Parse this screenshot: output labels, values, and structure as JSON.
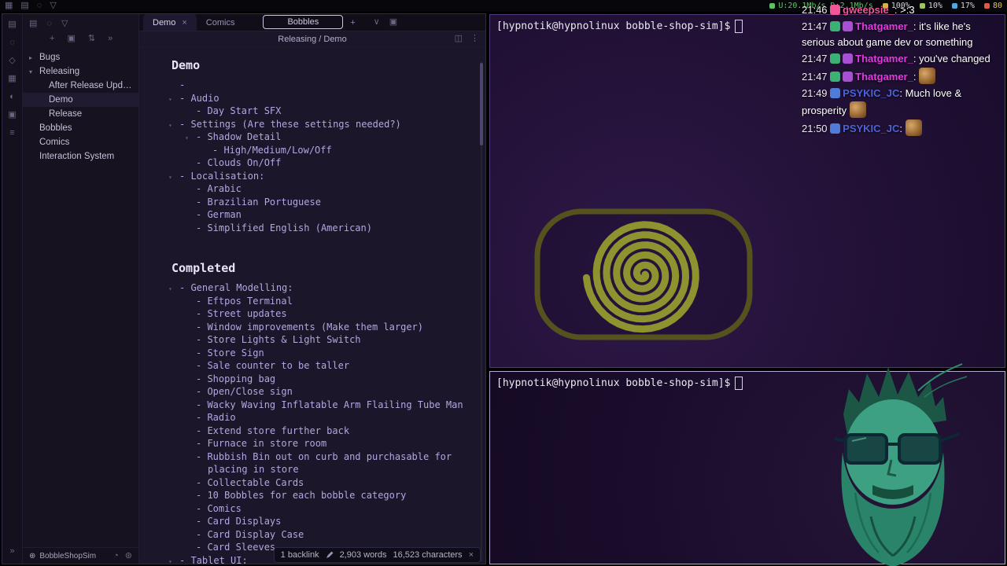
{
  "colors": {
    "accent_purple": "#7a5dd6",
    "focused_border": "#b7a6d3",
    "terminal_bg": "#241239",
    "editor_text": "#b4a7e2"
  },
  "topbar": {
    "left_icons": [
      {
        "name": "apps-icon",
        "glyph": "▦"
      },
      {
        "name": "layout-icon",
        "glyph": "▤"
      },
      {
        "name": "search-icon",
        "glyph": "◌"
      },
      {
        "name": "bookmark-icon",
        "glyph": "▽"
      }
    ],
    "stats": [
      {
        "name": "network",
        "text": "U:20.1Mb/s D:2.1Mb/s",
        "color": "#5dc264",
        "dot": "#5dc264"
      },
      {
        "name": "volume",
        "text": "100%",
        "color": "#d6d3de",
        "dot": "#d4b544"
      },
      {
        "name": "brightness",
        "text": "10%",
        "color": "#d6d3de",
        "dot": "#9ec45a"
      },
      {
        "name": "disk-usage",
        "text": "17%",
        "color": "#d6d3de",
        "dot": "#4fa7dd"
      },
      {
        "name": "cpu-temp",
        "text": "80",
        "color": "#e0c25a",
        "dot": "#de5948"
      }
    ]
  },
  "obsidian": {
    "ribbon_icons": [
      {
        "name": "files-icon",
        "glyph": "▤"
      },
      {
        "name": "search-icon",
        "glyph": "◌"
      },
      {
        "name": "graph-icon",
        "glyph": "◇"
      },
      {
        "name": "canvas-icon",
        "glyph": "▦"
      },
      {
        "name": "daily-note-icon",
        "glyph": "◐"
      },
      {
        "name": "templates-icon",
        "glyph": "▣"
      },
      {
        "name": "command-icon",
        "glyph": "≡"
      }
    ],
    "sidebar": {
      "tab_icons": [
        {
          "name": "explorer-tab-icon",
          "glyph": "▤"
        },
        {
          "name": "search-tab-icon",
          "glyph": "◌"
        },
        {
          "name": "bookmarks-tab-icon",
          "glyph": "▽"
        }
      ],
      "action_icons": [
        {
          "name": "new-note-icon",
          "glyph": "+"
        },
        {
          "name": "new-folder-icon",
          "glyph": "▣"
        },
        {
          "name": "sort-icon",
          "glyph": "⇅"
        },
        {
          "name": "collapse-all-icon",
          "glyph": "»"
        }
      ],
      "tree": [
        {
          "label": "Bugs",
          "level": 0,
          "children": true,
          "collapsed": true
        },
        {
          "label": "Releasing",
          "level": 0,
          "children": true,
          "collapsed": false
        },
        {
          "label": "After Release Upd…",
          "level": 1
        },
        {
          "label": "Demo",
          "level": 1,
          "active": true
        },
        {
          "label": "Release",
          "level": 1
        },
        {
          "label": "Bobbles",
          "level": 0
        },
        {
          "label": "Comics",
          "level": 0
        },
        {
          "label": "Interaction System",
          "level": 0
        }
      ]
    },
    "vault": {
      "icon": "⊕",
      "name": "BobbleShopSim",
      "action_icons": [
        {
          "name": "sync-icon",
          "glyph": "◔"
        },
        {
          "name": "settings-icon",
          "glyph": "⊛"
        }
      ]
    },
    "tabs": {
      "items": [
        {
          "label": "Demo",
          "active": true,
          "close": true
        },
        {
          "label": "Comics"
        },
        {
          "label": "Bobbles",
          "outlined": true
        }
      ],
      "new_tab": "+",
      "extra_icons": [
        {
          "name": "tab-dropdown-icon",
          "glyph": "∨"
        },
        {
          "name": "stack-tabs-icon",
          "glyph": "▣"
        }
      ]
    },
    "view_header": {
      "breadcrumb": "Releasing / Demo",
      "action_icons": [
        {
          "name": "reading-view-icon",
          "glyph": "◫"
        },
        {
          "name": "more-options-icon",
          "glyph": "⋮"
        }
      ]
    },
    "note": {
      "heading1": "Demo",
      "section1": [
        {
          "i": 0,
          "t": ""
        },
        {
          "i": 0,
          "t": "Audio",
          "fold": true
        },
        {
          "i": 1,
          "t": "Day Start SFX"
        },
        {
          "i": 0,
          "t": "Settings (Are these settings needed?)",
          "fold": true
        },
        {
          "i": 1,
          "t": "Shadow Detail",
          "fold": true
        },
        {
          "i": 2,
          "t": "High/Medium/Low/Off"
        },
        {
          "i": 1,
          "t": "Clouds On/Off"
        },
        {
          "i": 0,
          "t": "Localisation:",
          "fold": true
        },
        {
          "i": 1,
          "t": "Arabic"
        },
        {
          "i": 1,
          "t": "Brazilian Portuguese"
        },
        {
          "i": 1,
          "t": "German"
        },
        {
          "i": 1,
          "t": "Simplified English (American)"
        }
      ],
      "heading2": "Completed",
      "section2": [
        {
          "i": 0,
          "t": "General Modelling:",
          "fold": true
        },
        {
          "i": 1,
          "t": "Eftpos Terminal"
        },
        {
          "i": 1,
          "t": "Street updates"
        },
        {
          "i": 1,
          "t": "Window improvements (Make them larger)"
        },
        {
          "i": 1,
          "t": "Store Lights & Light Switch"
        },
        {
          "i": 1,
          "t": "Store Sign"
        },
        {
          "i": 1,
          "t": "Sale counter to be taller"
        },
        {
          "i": 1,
          "t": "Shopping bag"
        },
        {
          "i": 1,
          "t": "Open/Close sign"
        },
        {
          "i": 1,
          "t": "Wacky Waving Inflatable Arm Flailing Tube Man"
        },
        {
          "i": 1,
          "t": "Radio"
        },
        {
          "i": 1,
          "t": "Extend store further back"
        },
        {
          "i": 1,
          "t": "Furnace in store room"
        },
        {
          "i": 1,
          "t": "Rubbish Bin out on curb and purchasable for placing in store"
        },
        {
          "i": 1,
          "t": "Collectable Cards"
        },
        {
          "i": 1,
          "t": "10 Bobbles for each bobble category"
        },
        {
          "i": 1,
          "t": "Comics"
        },
        {
          "i": 1,
          "t": "Card Displays"
        },
        {
          "i": 1,
          "t": "Card Display Case"
        },
        {
          "i": 1,
          "t": "Card Sleeves"
        },
        {
          "i": 0,
          "t": "Tablet UI:",
          "fold": true
        }
      ]
    },
    "status_popup": {
      "backlinks": "1 backlink",
      "words": "2,903 words",
      "characters": "16,523 characters",
      "close": "×"
    }
  },
  "terminals": {
    "prompt": "[hypnotik@hypnolinux bobble-shop-sim]$"
  },
  "chat": {
    "messages": [
      {
        "time": "21:46",
        "badges": [
          "#f2569a"
        ],
        "user": "gweepsie_",
        "color": "#f2569a",
        "text": ">:3"
      },
      {
        "time": "21:47",
        "badges": [
          "#3bb273",
          "#a84fd3"
        ],
        "user": "Thatgamer_",
        "color": "#e23ae2",
        "text": "it's like he's serious about game dev or something"
      },
      {
        "time": "21:47",
        "badges": [
          "#3bb273",
          "#a84fd3"
        ],
        "user": "Thatgamer_",
        "color": "#e23ae2",
        "text": "you've changed"
      },
      {
        "time": "21:47",
        "badges": [
          "#3bb273",
          "#a84fd3"
        ],
        "user": "Thatgamer_",
        "color": "#e23ae2",
        "text": "",
        "emote": "monkey"
      },
      {
        "time": "21:49",
        "badges": [
          "#4f7bd9"
        ],
        "user": "PSYKIC_JC",
        "color": "#4b63d6",
        "text": "Much love & prosperity",
        "emote": "pray"
      },
      {
        "time": "21:50",
        "badges": [
          "#4f7bd9"
        ],
        "user": "PSYKIC_JC",
        "color": "#4b63d6",
        "text": "",
        "emote": "monkey-face"
      }
    ]
  }
}
